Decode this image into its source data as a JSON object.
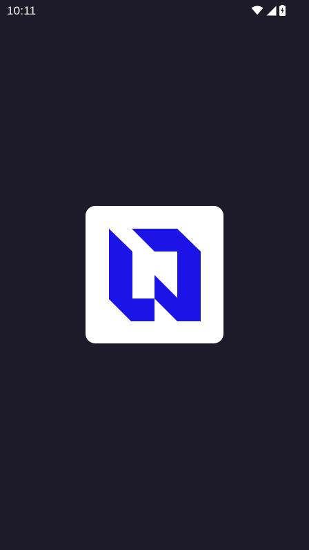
{
  "status_bar": {
    "time": "10:11",
    "icons": [
      "wifi-icon",
      "cellular-signal-icon",
      "battery-charging-icon"
    ]
  },
  "splash": {
    "logo_icon": "app-logo-icon",
    "logo_background": "#ffffff",
    "logo_color": "#1c14e6"
  },
  "colors": {
    "background": "#1d1a29",
    "status_text": "#ffffff"
  }
}
